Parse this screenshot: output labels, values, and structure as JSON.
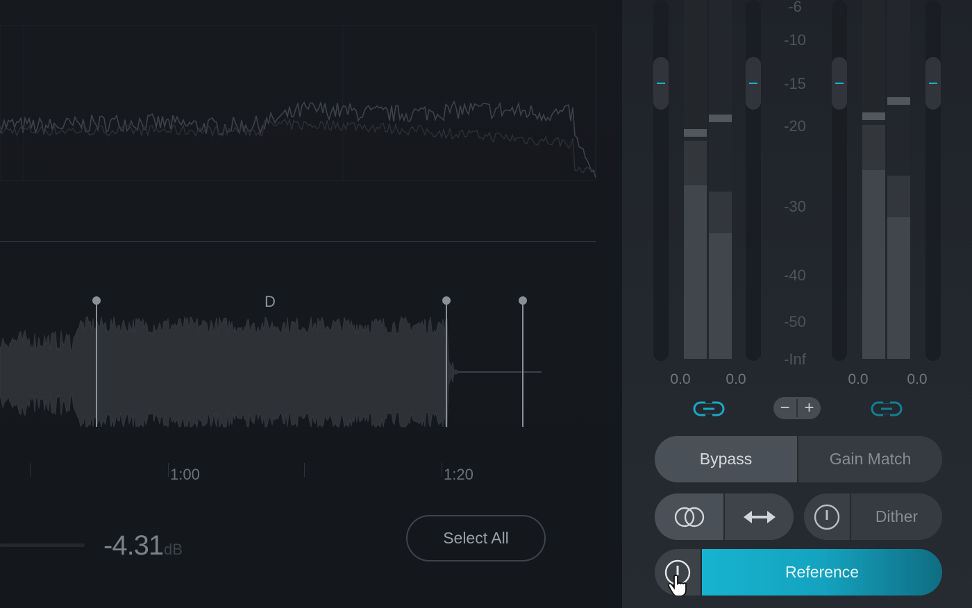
{
  "waveform": {
    "markers": [
      {
        "label": ""
      },
      {
        "label": "D"
      },
      {
        "label": ""
      },
      {
        "label": ""
      }
    ],
    "time_labels": [
      "1:00",
      "1:20"
    ]
  },
  "gain": {
    "value": "-4.31",
    "unit": "dB"
  },
  "select_all_label": "Select All",
  "meters": {
    "scale": [
      "-6",
      "-10",
      "-15",
      "-20",
      "-30",
      "-40",
      "-50",
      "-Inf"
    ],
    "input_values": [
      "0.0",
      "0.0"
    ],
    "output_values": [
      "0.0",
      "0.0"
    ],
    "trim": {
      "minus": "−",
      "plus": "+"
    }
  },
  "buttons": {
    "bypass": "Bypass",
    "gain_match": "Gain Match",
    "dither": "Dither",
    "reference": "Reference"
  },
  "colors": {
    "accent": "#17b3d0",
    "button_active": "#4a5057",
    "button_bg": "#363b42"
  },
  "icons": {
    "stereo": "stereo-circles-icon",
    "width": "stereo-width-arrows-icon",
    "dither_power": "power-icon",
    "reference_power": "power-icon",
    "cursor": "hand-pointer-icon",
    "link": "link-icon"
  }
}
